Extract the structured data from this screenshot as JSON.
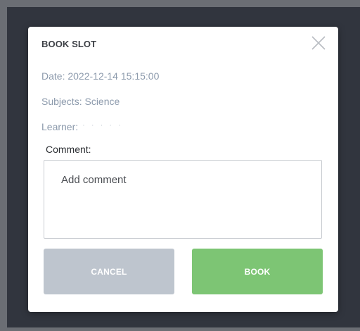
{
  "modal": {
    "title": "BOOK SLOT",
    "close_icon": "close-x-icon",
    "date": "Date: 2022-12-14 15:15:00",
    "subjects": "Subjects: Science",
    "learner_label": "Learner:",
    "learner_value": "· · · · ·",
    "comment_label": "Comment:",
    "comment_placeholder": "Add comment",
    "comment_value": "",
    "cancel_label": "CANCEL",
    "book_label": "BOOK"
  },
  "colors": {
    "backdrop": "#31353e",
    "info_text": "#8c9aac",
    "cancel_bg": "#bec5ce",
    "book_bg": "#7dc574"
  }
}
